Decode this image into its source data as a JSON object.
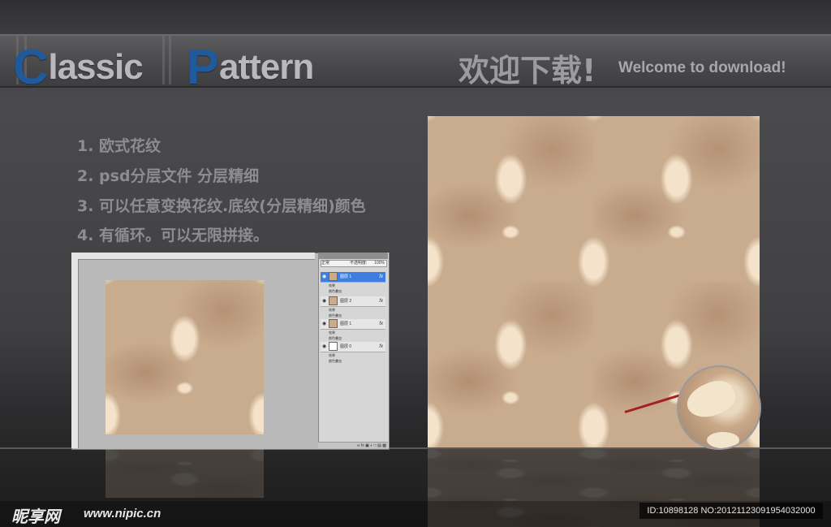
{
  "header": {
    "title_word1": {
      "cap": "C",
      "rest": "lassic"
    },
    "title_word2": {
      "cap": "P",
      "rest": "attern"
    },
    "welcome_cn": "欢迎下载!",
    "welcome_en": "Welcome to download!"
  },
  "features": [
    "1. 欧式花纹",
    "2. psd分层文件 分层精细",
    "3. 可以任意变换花纹.底纹(分层精细)颜色",
    "4. 有循环。可以无限拼接。"
  ],
  "ps_panel": {
    "tabs": [
      "图层",
      "通道",
      "路径",
      "历史记录",
      "Video Grade"
    ],
    "blend_mode": "正常",
    "opacity_label": "不透明度:",
    "opacity_value": "100%",
    "fill_value": "100%",
    "layers": [
      {
        "name": "图层 1",
        "sub": [
          "效果",
          "颜色叠加"
        ],
        "selected": true
      },
      {
        "name": "图层 2",
        "sub": [
          "效果",
          "颜色叠加"
        ],
        "selected": false
      },
      {
        "name": "图层 1",
        "sub": [
          "效果",
          "颜色叠加"
        ],
        "selected": false
      },
      {
        "name": "图层 0",
        "sub": [
          "效果",
          "颜色叠加"
        ],
        "selected": false
      }
    ],
    "fx_label": "fx"
  },
  "footer": {
    "site_name": "昵享网",
    "site_url": "www.nipic.cn",
    "id_text": "ID:10898128 NO:20121123091954032000"
  },
  "colors": {
    "title_accent": "#1e5a9c",
    "pattern_base": "#c9ab8e",
    "pattern_motif": "#f6e6cd",
    "pointer": "#a32020"
  }
}
